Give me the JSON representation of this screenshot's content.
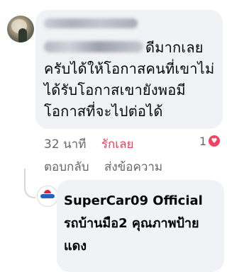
{
  "comment": {
    "text_line1": "ดีมากเลย",
    "text_rest": "ครับได้ให้โอกาสคนที่เขาไม่ได้รับโอกาสเขายังพอมีโอกาสที่จะไปต่อได้",
    "time": "32 นาที",
    "reaction_label": "รักเลย",
    "reaction_count": "1",
    "reply_label": "ตอบกลับ",
    "message_label": "ส่งข้อความ"
  },
  "reply": {
    "author": "SuperCar09 Official",
    "text": "รถบ้านมือ2 คุณภาพป้ายแดง"
  },
  "colors": {
    "bubble": "#f0f2f5",
    "love": "#f3425f",
    "meta": "#65676b"
  }
}
